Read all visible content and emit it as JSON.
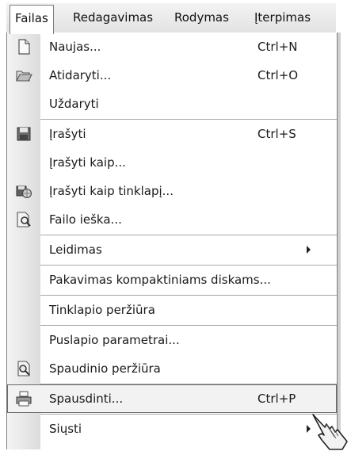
{
  "menubar": {
    "items": [
      {
        "label": "Failas"
      },
      {
        "label": "Redagavimas"
      },
      {
        "label": "Rodymas"
      },
      {
        "label": "Įterpimas"
      }
    ]
  },
  "menu": {
    "items": [
      {
        "label": "Naujas...",
        "shortcut": "Ctrl+N",
        "icon": "new-document-icon"
      },
      {
        "label": "Atidaryti...",
        "shortcut": "Ctrl+O",
        "icon": "open-folder-icon"
      },
      {
        "label": "Uždaryti"
      },
      {
        "label": "Įrašyti",
        "shortcut": "Ctrl+S",
        "icon": "save-disk-icon"
      },
      {
        "label": "Įrašyti kaip..."
      },
      {
        "label": "Įrašyti kaip tinklapį...",
        "icon": "save-as-web-page-icon"
      },
      {
        "label": "Failo ieška...",
        "icon": "file-search-icon"
      },
      {
        "label": "Leidimas",
        "submenu": true
      },
      {
        "label": "Pakavimas kompaktiniams diskams..."
      },
      {
        "label": "Tinklapio peržiūra"
      },
      {
        "label": "Puslapio parametrai..."
      },
      {
        "label": "Spaudinio peržiūra",
        "icon": "print-preview-icon"
      },
      {
        "label": "Spausdinti...",
        "shortcut": "Ctrl+P",
        "icon": "printer-icon",
        "selected": true
      },
      {
        "label": "Siųsti",
        "submenu": true
      }
    ]
  },
  "cursor": {
    "icon": "hand-pointer-icon"
  }
}
